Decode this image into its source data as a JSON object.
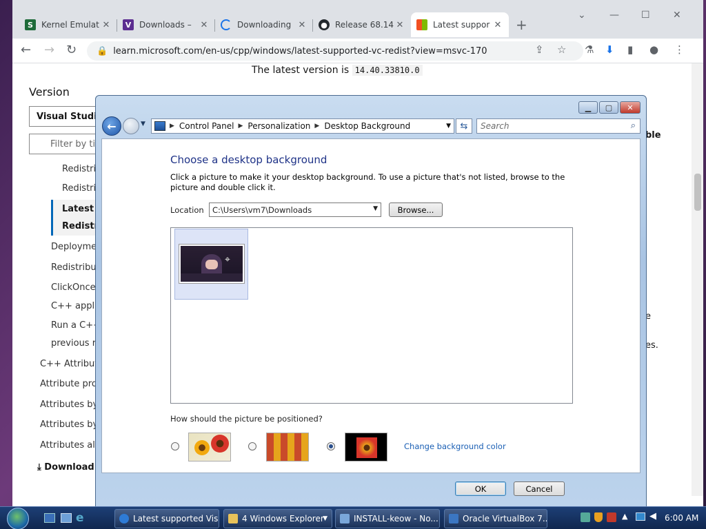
{
  "browser": {
    "tabs": [
      {
        "title": "Kernel Emulat",
        "icon": "s-icon",
        "color": "#1e6b3a"
      },
      {
        "title": "Downloads –",
        "icon": "vs-icon",
        "color": "#5c2d91"
      },
      {
        "title": "Downloading",
        "icon": "spinner-icon",
        "color": "#1a73e8"
      },
      {
        "title": "Release 68.14",
        "icon": "github-icon",
        "color": "#24292e"
      },
      {
        "title": "Latest suppor",
        "icon": "microsoft-icon",
        "color": "#f25022"
      }
    ],
    "new_tab": "+",
    "url": "learn.microsoft.com/en-us/cpp/windows/latest-supported-vc-redist?view=msvc-170"
  },
  "page": {
    "latest_text": "The latest version is",
    "latest_version": "14.40.33810.0",
    "version_heading": "Version",
    "version_select": "Visual Studi",
    "filter_placeholder": "Filter by tit",
    "toc": [
      "Redistrib",
      "Redistrib",
      "Latest",
      "Redistr",
      "Deploymen",
      "Redistribut",
      "ClickOnce",
      "C++ appli",
      "Run a C++",
      "previous r",
      "C++ Attribut",
      "Attribute pro",
      "Attributes by",
      "Attributes by",
      "Attributes alp",
      "Download"
    ],
    "right_fragments": [
      "ble",
      "e",
      "es."
    ]
  },
  "dialog": {
    "breadcrumbs": [
      "Control Panel",
      "Personalization",
      "Desktop Background"
    ],
    "search_placeholder": "Search",
    "heading": "Choose a desktop background",
    "description": "Click a picture to make it your desktop background. To use a picture that's not listed, browse to the picture and double click it.",
    "location_label": "Location",
    "location_value": "C:\\Users\\vm7\\Downloads",
    "browse_label": "Browse...",
    "position_question": "How should the picture be positioned?",
    "change_color_label": "Change background color",
    "ok_label": "OK",
    "cancel_label": "Cancel"
  },
  "taskbar": {
    "items": [
      {
        "label": "Latest supported Vis...",
        "color": "#2e7bd6"
      },
      {
        "label": "4 Windows Explorer",
        "color": "#e8c25a"
      },
      {
        "label": "INSTALL-keow - No...",
        "color": "#7aa7d9"
      },
      {
        "label": "Oracle VirtualBox 7....",
        "color": "#3b76c2"
      }
    ],
    "clock": "6:00 AM"
  }
}
